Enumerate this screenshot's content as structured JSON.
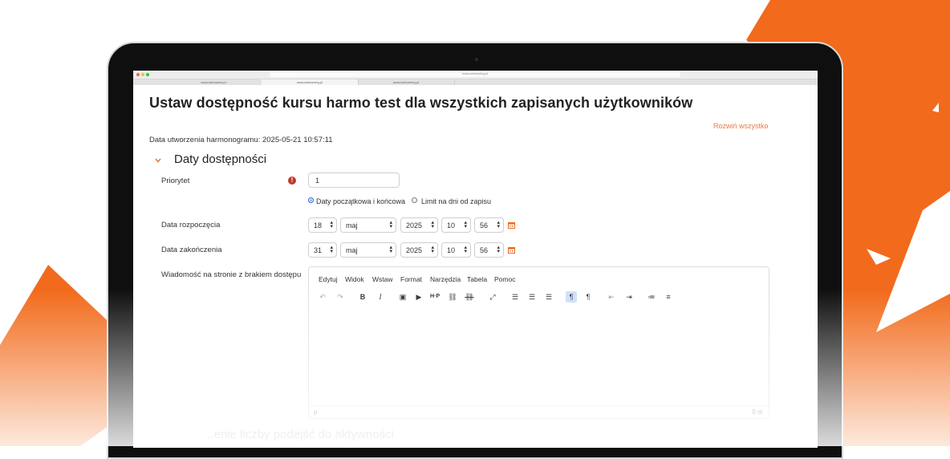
{
  "browser": {
    "address": "www.webcentrg.pl",
    "tabs": [
      "www.semaview.pl",
      "www.webcentrg.pl",
      "www.webcentrg.pl"
    ]
  },
  "page": {
    "title": "Ustaw dostępność kursu harmo test dla wszystkich zapisanych użytkowników",
    "expand_all": "Rozwiń wszystko",
    "created": "Data utworzenia harmonogramu: 2025-05-21 10:57:11",
    "section_title": "Daty dostępności",
    "next_section": "...enie liczby podejść do aktywności"
  },
  "form": {
    "priority_label": "Priorytet",
    "priority_value": "1",
    "radio_option_1": "Daty początkowa i końcowa",
    "radio_option_2": "Limit na dni od zapisu",
    "start_label": "Data rozpoczęcia",
    "start": {
      "day": "18",
      "month": "maj",
      "year": "2025",
      "hour": "10",
      "minute": "56"
    },
    "end_label": "Data zakończenia",
    "end": {
      "day": "31",
      "month": "maj",
      "year": "2025",
      "hour": "10",
      "minute": "56"
    },
    "message_label": "Wiadomość na stronie z brakiem dostępu"
  },
  "editor": {
    "menu": [
      "Edytuj",
      "Widok",
      "Wstaw",
      "Format",
      "Narzędzia",
      "Tabela",
      "Pomoc"
    ],
    "status_path": "p",
    "word_count": "0 sł."
  },
  "icons": [
    "undo-icon",
    "redo-icon",
    "bold-icon",
    "italic-icon",
    "image-icon",
    "media-icon",
    "h5p-icon",
    "link-icon",
    "unlink-icon",
    "fullscreen-icon",
    "align-left-icon",
    "align-center-icon",
    "align-right-icon",
    "ltr-icon",
    "rtl-icon",
    "outdent-icon",
    "indent-icon",
    "bullet-list-icon",
    "numbered-list-icon",
    "calendar-icon",
    "error-icon",
    "chevron-down-icon"
  ],
  "colors": {
    "accent": "#f26a1b",
    "link": "#e87a3c",
    "error": "#c0392b",
    "radio": "#2a66d9"
  }
}
